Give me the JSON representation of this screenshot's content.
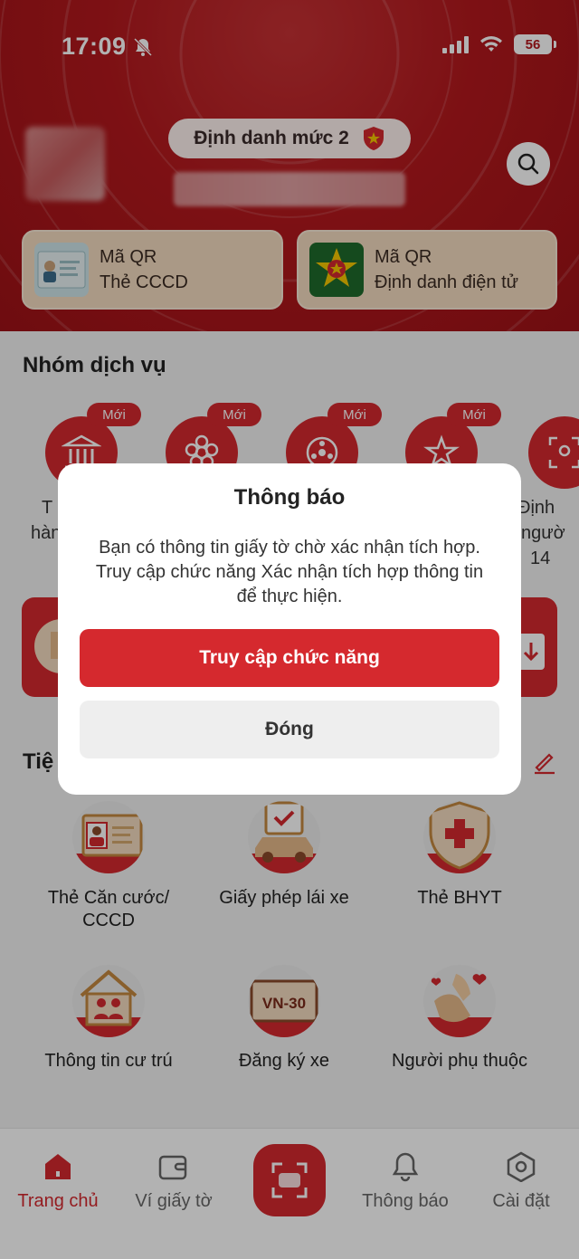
{
  "status_bar": {
    "time": "17:09",
    "battery": "56"
  },
  "header": {
    "level_label": "Định danh mức 2",
    "qr_cards": [
      {
        "line1": "Mã QR",
        "line2": "Thẻ CCCD"
      },
      {
        "line1": "Mã QR",
        "line2": "Định danh điện tử"
      }
    ]
  },
  "service_group": {
    "title": "Nhóm dịch vụ",
    "badge": "Mới",
    "partial_labels": [
      "T",
      "hàn",
      "Định",
      "ngườ",
      "14"
    ]
  },
  "utilities": {
    "title_partial": "Tiệ",
    "items": [
      {
        "label_line1": "Thẻ Căn cước/",
        "label_line2": "CCCD",
        "icon": "id-card-icon"
      },
      {
        "label_line1": "Giấy phép lái xe",
        "label_line2": "",
        "icon": "car-license-icon"
      },
      {
        "label_line1": "Thẻ BHYT",
        "label_line2": "",
        "icon": "health-shield-icon"
      },
      {
        "label_line1": "Thông tin cư trú",
        "label_line2": "",
        "icon": "house-family-icon"
      },
      {
        "label_line1": "Đăng ký xe",
        "label_line2": "",
        "icon": "plate-icon",
        "plate_text": "VN-30"
      },
      {
        "label_line1": "Người phụ thuộc",
        "label_line2": "",
        "icon": "hands-heart-icon"
      }
    ]
  },
  "nav": {
    "items": [
      {
        "label": "Trang chủ",
        "icon": "home-icon"
      },
      {
        "label": "Ví giấy tờ",
        "icon": "wallet-icon"
      },
      {
        "label": "Thông báo",
        "icon": "bell-icon"
      },
      {
        "label": "Cài đặt",
        "icon": "settings-icon"
      }
    ]
  },
  "dialog": {
    "title": "Thông báo",
    "message": "Bạn có thông tin giấy tờ chờ xác nhận tích hợp. Truy cập chức năng Xác nhận tích hợp thông tin để thực hiện.",
    "primary_label": "Truy cập chức năng",
    "secondary_label": "Đóng"
  },
  "colors": {
    "brand_red": "#d5292e",
    "header_red": "#b3181d",
    "card_beige": "#f4dcc0"
  }
}
